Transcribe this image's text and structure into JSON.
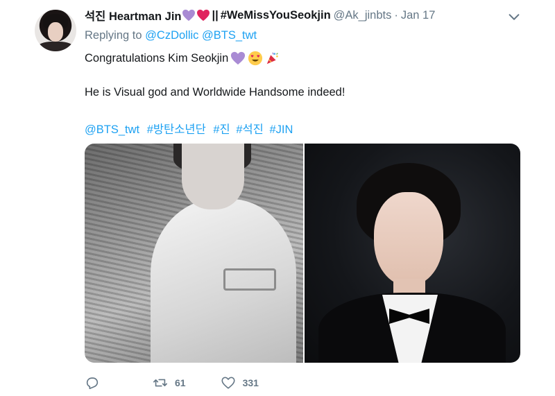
{
  "tweet": {
    "display_name": "석진 Heartman Jin",
    "name_hashtag": "#WeMissYouSeokjin",
    "name_separator": "||",
    "handle": "@Ak_jinbts",
    "dot": "·",
    "date": "Jan 17",
    "reply_prefix": "Replying to",
    "reply_mentions": [
      "@CzDollic",
      "@BTS_twt"
    ],
    "text_line1": "Congratulations Kim Seokjin",
    "text_line2": "He is Visual god and Worldwide Handsome indeed!",
    "hashtags": [
      "@BTS_twt",
      "#방탄소년단",
      "#진",
      "#석진",
      "#JIN"
    ],
    "retweet_count": "61",
    "like_count": "331"
  },
  "icons": {
    "menu": "chevron-down-icon",
    "reply": "reply-icon",
    "retweet": "retweet-icon",
    "like": "heart-icon",
    "name_emojis": [
      "purple-heart-icon",
      "red-heart-icon"
    ],
    "text_emojis": [
      "purple-heart-icon",
      "heart-eyes-emoji-icon",
      "party-popper-icon"
    ]
  },
  "colors": {
    "link": "#1da1f2",
    "secondary_text": "#657786",
    "purple_heart": "#a98bd4",
    "red_heart": "#e0245e"
  }
}
